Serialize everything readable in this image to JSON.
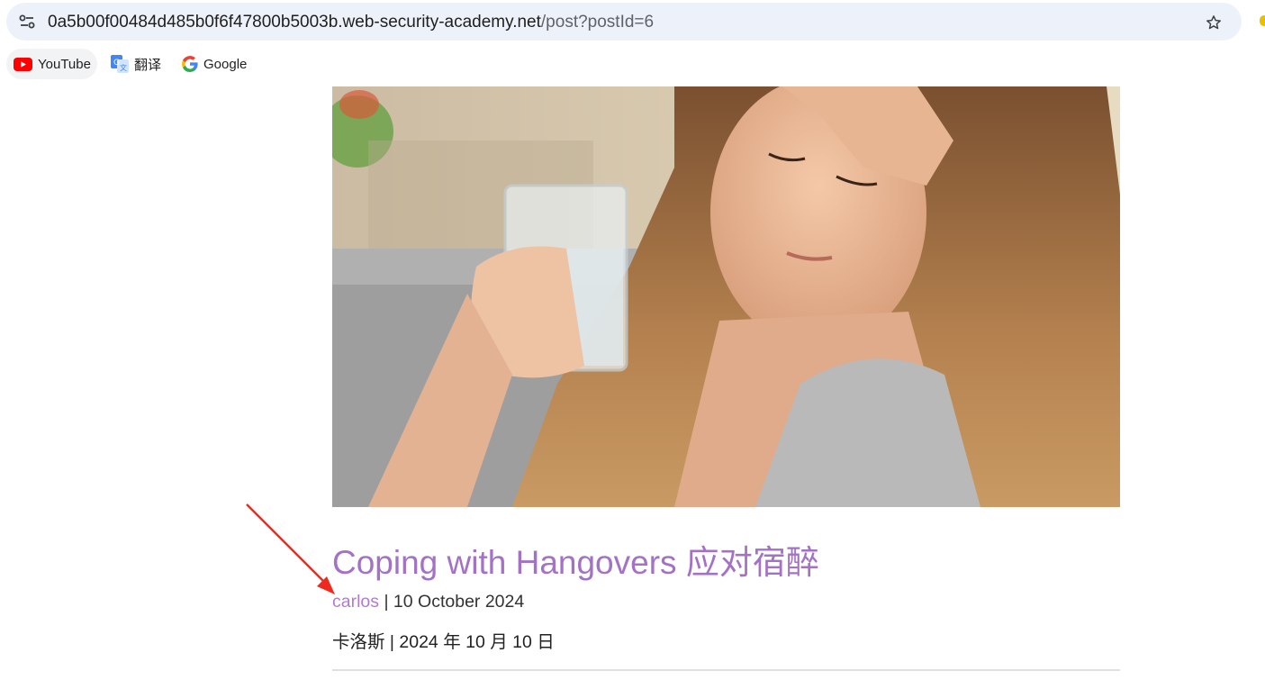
{
  "browser": {
    "url_domain": "0a5b00f00484d485b0f6f47800b5003b.web-security-academy.net",
    "url_path": "/post?postId=6"
  },
  "bookmarks": [
    {
      "label": "YouTube",
      "icon": "youtube-icon"
    },
    {
      "label": "翻译",
      "icon": "translate-icon"
    },
    {
      "label": "Google",
      "icon": "google-icon"
    }
  ],
  "post": {
    "title": "Coping with Hangovers 应对宿醉",
    "author": "carlos",
    "date_separator": " | 10 October 2024",
    "translated_meta": "卡洛斯 | 2024 年 10 月 10 日"
  },
  "colors": {
    "title": "#a472c5",
    "author_link": "#b27bd1",
    "annotation_arrow": "#ee2a1f"
  }
}
